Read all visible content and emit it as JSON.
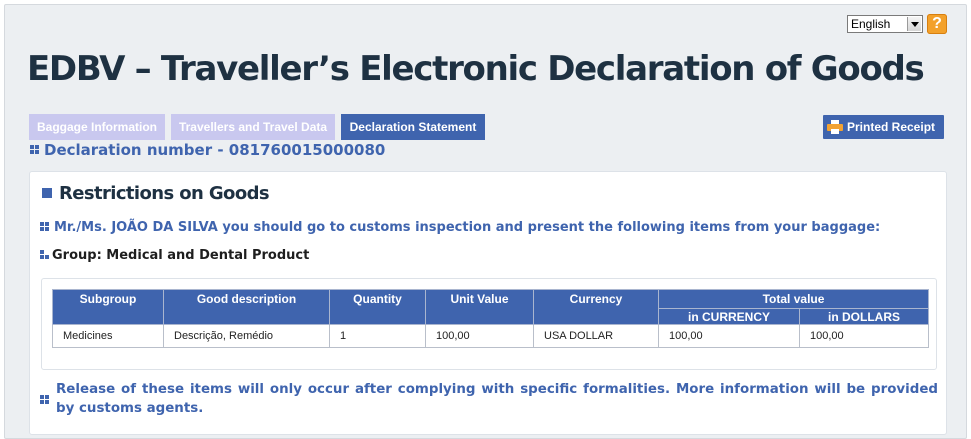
{
  "header": {
    "language": {
      "selected": "English"
    },
    "help_icon": "question-mark",
    "title": "EDBV – Traveller’s Electronic Declaration of Goods"
  },
  "tabs": [
    {
      "label": "Baggage Information",
      "active": false
    },
    {
      "label": "Travellers and Travel Data",
      "active": false
    },
    {
      "label": "Declaration Statement",
      "active": true
    }
  ],
  "toolbar": {
    "printed_receipt_label": "Printed Receipt",
    "printed_receipt_icon": "printer"
  },
  "declaration": {
    "number_text": "Declaration number - 081760015000080"
  },
  "restrictions": {
    "title": "Restrictions on Goods",
    "notice": "Mr./Ms. JOÃO DA SILVA you should go to customs inspection and present the following items from your baggage:",
    "group": "Group: Medical and Dental Product",
    "table": {
      "headers": {
        "subgroup": "Subgroup",
        "description": "Good description",
        "quantity": "Quantity",
        "unit_value": "Unit Value",
        "currency": "Currency",
        "total_value": "Total value",
        "in_currency": "in CURRENCY",
        "in_dollars": "in DOLLARS"
      },
      "rows": [
        {
          "subgroup": "Medicines",
          "description": "Descrição, Remédio",
          "quantity": "1",
          "unit_value": "100,00",
          "currency": "USA DOLLAR",
          "in_currency": "100,00",
          "in_dollars": "100,00"
        }
      ]
    },
    "footer_note": "Release of these items will only occur after complying with specific formalities. More information will be provided by customs agents."
  },
  "colors": {
    "accent": "#3f64ae",
    "tab_inactive": "#c9c8ef",
    "title": "#1e3142",
    "help": "#f3a12b"
  }
}
